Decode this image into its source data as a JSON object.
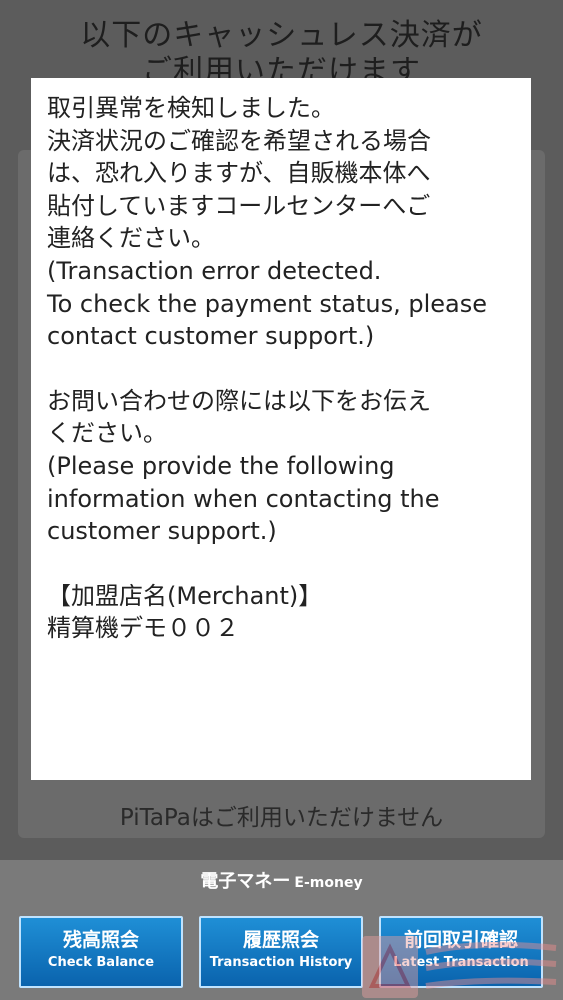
{
  "background": {
    "title_line1": "以下のキャッシュレス決済が",
    "title_line2": "ご利用いただけます",
    "notice": "PiTaPaはご利用いただけません"
  },
  "dialog": {
    "jp_error_1": "取引異常を検知しました。",
    "jp_error_2": "決済状況のご確認を希望される場合",
    "jp_error_3": "は、恐れ入りますが、自販機本体へ",
    "jp_error_4": "貼付していますコールセンターへご",
    "jp_error_5": "連絡ください。",
    "en_error_1": "(Transaction error detected.",
    "en_error_2": "To check the payment status, please",
    "en_error_3": "contact customer support.)",
    "jp_info_1": "お問い合わせの際には以下をお伝え",
    "jp_info_2": "ください。",
    "en_info_1": "(Please provide the following",
    "en_info_2": "information when contacting the",
    "en_info_3": "customer support.)",
    "merchant_label": "【加盟店名(Merchant)】",
    "merchant_value": "精算機デモ００２"
  },
  "emoney": {
    "title_jp": "電子マネー",
    "title_en": "E-money",
    "buttons": [
      {
        "jp": "残高照会",
        "en": "Check Balance"
      },
      {
        "jp": "履歴照会",
        "en": "Transaction History"
      },
      {
        "jp": "前回取引確認",
        "en": "Latest Transaction"
      }
    ]
  },
  "colors": {
    "button_blue": "#0a63ad",
    "overlay_grey": "#5c5c5c",
    "watermark_red": "#e23a3a"
  }
}
